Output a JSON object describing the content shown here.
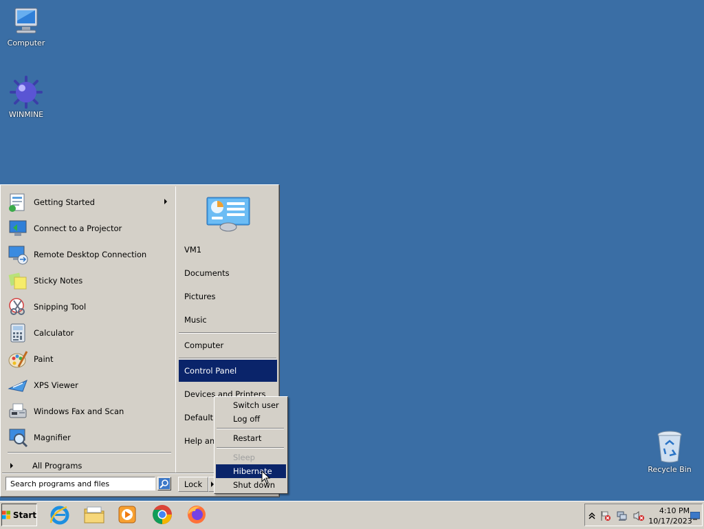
{
  "desktop": {
    "icons": [
      {
        "label": "Computer",
        "icon": "computer-icon"
      },
      {
        "label": "WINMINE",
        "icon": "mine-icon"
      },
      {
        "label": "Recycle Bin",
        "icon": "recycle-bin-icon"
      }
    ]
  },
  "start_menu": {
    "programs": [
      {
        "label": "Getting Started",
        "icon": "getting-started-icon",
        "submenu": true
      },
      {
        "label": "Connect to a Projector",
        "icon": "projector-icon"
      },
      {
        "label": "Remote Desktop Connection",
        "icon": "remote-desktop-icon"
      },
      {
        "label": "Sticky Notes",
        "icon": "sticky-notes-icon"
      },
      {
        "label": "Snipping Tool",
        "icon": "scissors-icon"
      },
      {
        "label": "Calculator",
        "icon": "calculator-icon"
      },
      {
        "label": "Paint",
        "icon": "paint-palette-icon"
      },
      {
        "label": "XPS Viewer",
        "icon": "xps-viewer-icon"
      },
      {
        "label": "Windows Fax and Scan",
        "icon": "fax-icon"
      },
      {
        "label": "Magnifier",
        "icon": "magnifier-icon"
      }
    ],
    "all_programs": "All Programs",
    "search_placeholder": "Search programs and files",
    "right_items": [
      {
        "label": "VM1"
      },
      {
        "label": "Documents"
      },
      {
        "label": "Pictures"
      },
      {
        "label": "Music"
      },
      {
        "label": "Computer"
      },
      {
        "label": "Control Panel",
        "selected": true
      },
      {
        "label": "Devices and Printers"
      },
      {
        "label": "Default Programs",
        "visible": "Default P"
      },
      {
        "label": "Help and Support",
        "visible": "Help and"
      }
    ],
    "lock_label": "Lock"
  },
  "power_menu": {
    "items": [
      {
        "label": "Switch user"
      },
      {
        "label": "Log off"
      },
      {
        "label": "Restart"
      },
      {
        "label": "Sleep",
        "disabled": true
      },
      {
        "label": "Hibernate",
        "selected": true
      },
      {
        "label": "Shut down"
      }
    ]
  },
  "taskbar": {
    "start_label": "Start",
    "apps": [
      "internet-explorer-icon",
      "file-explorer-icon",
      "media-player-icon",
      "chrome-icon",
      "firefox-icon"
    ],
    "clock": {
      "time": "4:10 PM",
      "date": "10/17/2023"
    }
  },
  "colors": {
    "desktop": "#3a6ea5",
    "selection": "#0a246a",
    "face": "#d4d0c8"
  }
}
